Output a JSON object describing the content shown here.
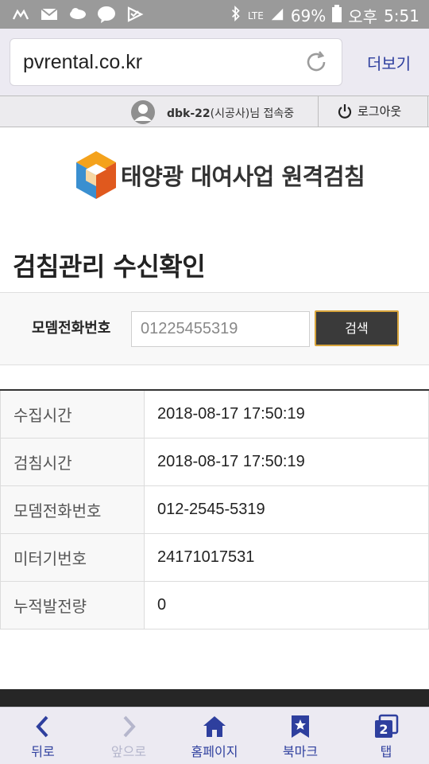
{
  "status_bar": {
    "battery": "69%",
    "network": "LTE",
    "ampm": "오후",
    "time": "5:51",
    "notification_icons": [
      "usb-icon",
      "mail-icon",
      "weather-icon",
      "talk-icon",
      "check-icon"
    ]
  },
  "browser": {
    "url": "pvrental.co.kr",
    "more_label": "더보기"
  },
  "user_bar": {
    "user_id": "dbk-22",
    "user_suffix": "(시공사)님 접속중",
    "logout_label": "로그아웃"
  },
  "logo": {
    "text": "태양광 대여사업 원격검침"
  },
  "page": {
    "title": "검침관리 수신확인"
  },
  "search": {
    "label": "모뎀전화번호",
    "value": "01225455319",
    "button_label": "검색"
  },
  "details": [
    {
      "key": "수집시간",
      "value": "2018-08-17 17:50:19"
    },
    {
      "key": "검침시간",
      "value": "2018-08-17 17:50:19"
    },
    {
      "key": "모뎀전화번호",
      "value": "012-2545-5319"
    },
    {
      "key": "미터기번호",
      "value": "24171017531"
    },
    {
      "key": "누적발전량",
      "value": "0"
    }
  ],
  "bottom_nav": {
    "back": "뒤로",
    "forward": "앞으로",
    "home": "홈페이지",
    "bookmark": "북마크",
    "tabs": "탭",
    "tab_count": "2"
  },
  "colors": {
    "accent": "#2e3f9e",
    "button_border": "#d7a43b",
    "button_bg": "#3a3a3a"
  }
}
